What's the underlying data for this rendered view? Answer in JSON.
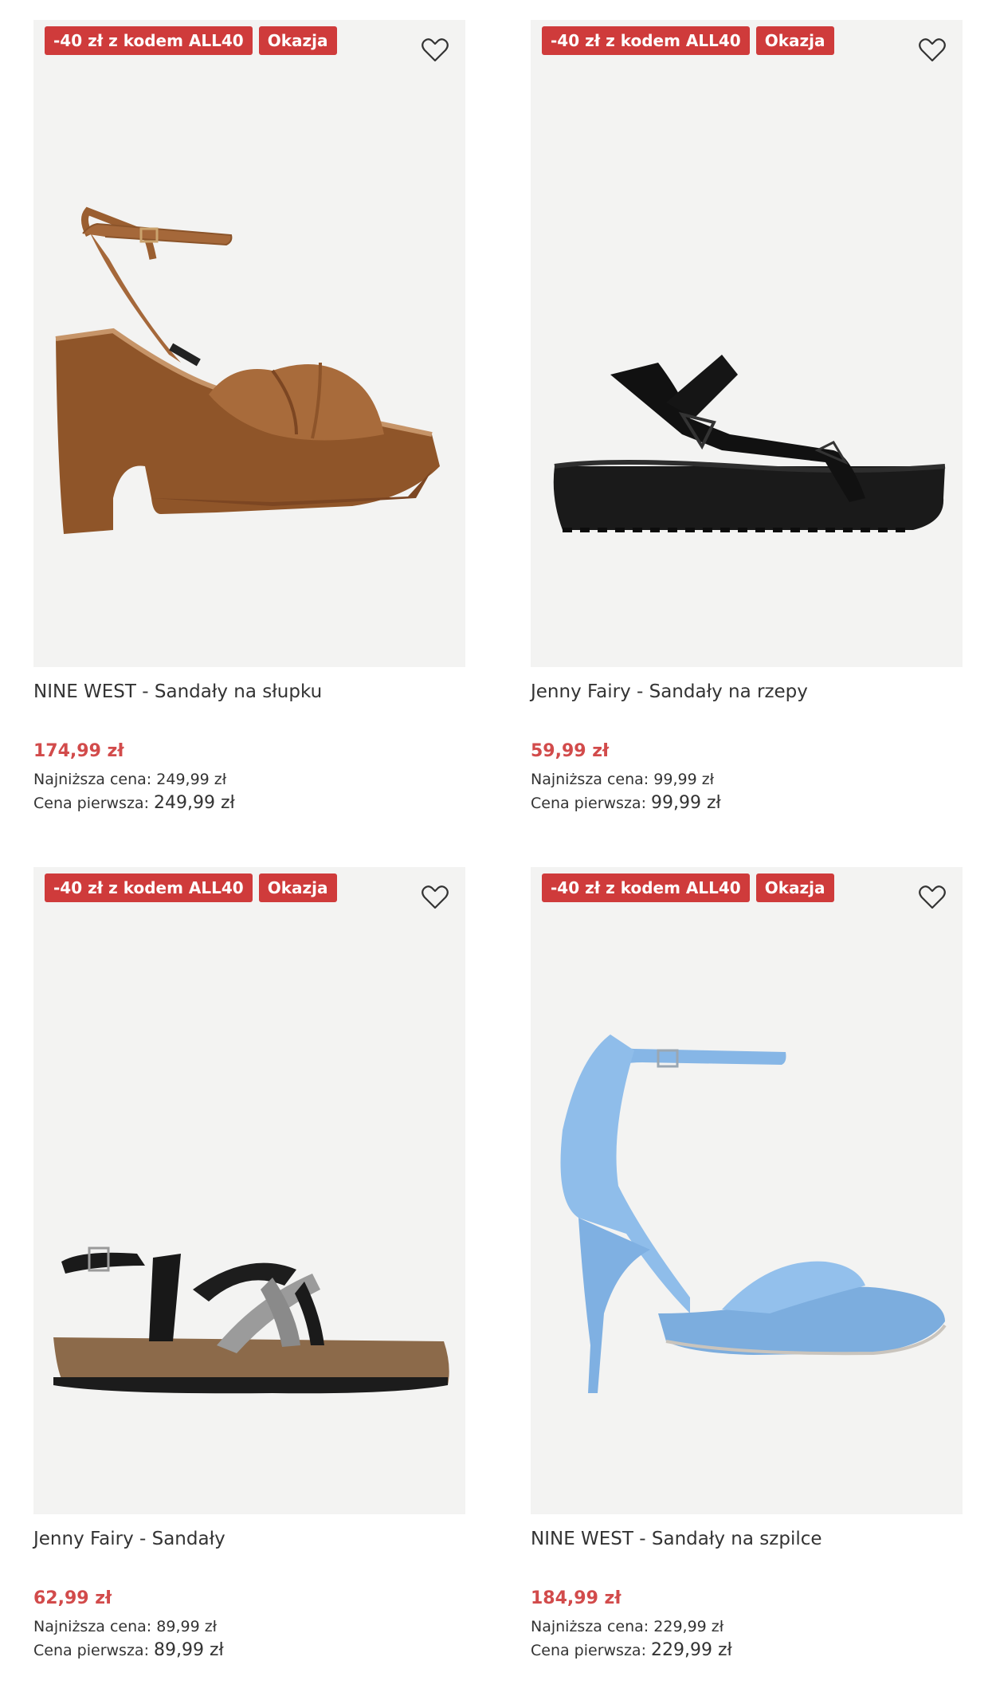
{
  "products": [
    {
      "promo_badge": "-40 zł z kodem ALL40",
      "deal_badge": "Okazja",
      "title": "NINE WEST - Sandały na słupku",
      "price": "174,99 zł",
      "lowest_label": "Najniższa cena:",
      "lowest_value": "249,99 zł",
      "first_label": "Cena pierwsza:",
      "first_value": "249,99 zł",
      "image": "brown-platform-block-heel-sandal"
    },
    {
      "promo_badge": "-40 zł z kodem ALL40",
      "deal_badge": "Okazja",
      "title": "Jenny Fairy - Sandały na rzepy",
      "price": "59,99 zł",
      "lowest_label": "Najniższa cena:",
      "lowest_value": "99,99 zł",
      "first_label": "Cena pierwsza:",
      "first_value": "99,99 zł",
      "image": "black-velcro-sport-sandal"
    },
    {
      "promo_badge": "-40 zł z kodem ALL40",
      "deal_badge": "Okazja",
      "title": "Jenny Fairy - Sandały",
      "price": "62,99 zł",
      "lowest_label": "Najniższa cena:",
      "lowest_value": "89,99 zł",
      "first_label": "Cena pierwsza:",
      "first_value": "89,99 zł",
      "image": "black-silver-cork-sandal"
    },
    {
      "promo_badge": "-40 zł z kodem ALL40",
      "deal_badge": "Okazja",
      "title": "NINE WEST - Sandały na szpilce",
      "price": "184,99 zł",
      "lowest_label": "Najniższa cena:",
      "lowest_value": "229,99 zł",
      "first_label": "Cena pierwsza:",
      "first_value": "229,99 zł",
      "image": "blue-stiletto-sandal"
    }
  ],
  "colors": {
    "badge": "#cf3b3b",
    "price": "#d24b4b",
    "image_bg": "#f3f3f2"
  }
}
